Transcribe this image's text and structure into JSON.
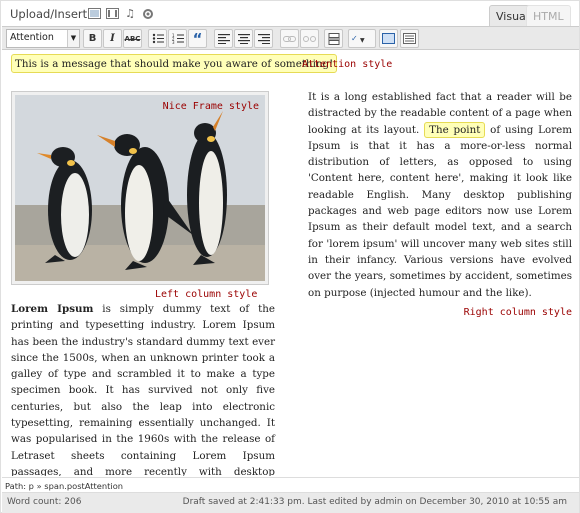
{
  "header": {
    "upload_label": "Upload/Insert",
    "media_icons": [
      "image-icon",
      "video-icon",
      "audio-icon",
      "media-icon"
    ],
    "tabs": [
      {
        "label": "Visual",
        "active": true
      },
      {
        "label": "HTML",
        "active": false
      }
    ]
  },
  "toolbar": {
    "style_value": "Attention",
    "bold": "B",
    "italic": "I",
    "strike": "ABC",
    "blockquote": "“"
  },
  "content": {
    "attention_text": "This is a message that should make you aware of something!",
    "attention_label": "Attention style",
    "nice_frame_label": "Nice Frame style",
    "left_column_label": "Left column style",
    "right_column_label": "Right column style",
    "left_col": {
      "lead": "Lorem Ipsum",
      "text": " is simply dummy text of the printing and typesetting industry. Lorem Ipsum has been the industry's standard dummy text ever since the 1500s, when an unknown printer took a galley of type and scrambled it to make a type specimen book. It has survived not only five centuries, but also the leap into electronic typesetting, remaining essentially unchanged. It was popularised in the 1960s with the release of Letraset sheets containing Lorem Ipsum passages, and more recently with desktop publishing software like Aldus PageMaker including versions of Lorem Ipsum."
    },
    "right_col": {
      "before": "It is a long established fact that a reader will be distracted by the readable content of a page when looking at its layout.",
      "point": "The point",
      "after": "of using Lorem Ipsum is that it has a more-or-less normal distribution of letters, as opposed to using 'Content here, content here', making it look like readable English. Many desktop publishing packages and web page editors now use Lorem Ipsum as their default model text, and a search for 'lorem ipsum' will uncover many web sites still in their infancy. Various versions have evolved over the years, sometimes by accident, sometimes on purpose (injected humour and the like)."
    }
  },
  "path_bar": "Path: p » span.postAttention",
  "status": {
    "word_count": "Word count: 206",
    "saved": "Draft saved at 2:41:33 pm. Last edited by admin on December 30, 2010 at 10:55 am"
  },
  "colors": {
    "attention_bg": "#ffffb8",
    "label_red": "#9a0000",
    "toolbar_bg": "#e9e9e9"
  }
}
